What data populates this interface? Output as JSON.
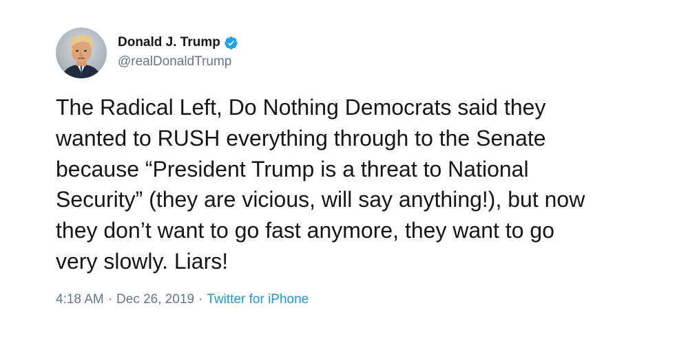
{
  "author": {
    "display_name": "Donald J. Trump",
    "handle": "@realDonaldTrump",
    "verified": true,
    "avatar_icon": "profile-photo"
  },
  "tweet": {
    "text": "The Radical Left, Do Nothing Democrats said they\nwanted to RUSH everything through to the Senate\nbecause “President Trump is a threat to National\nSecurity” (they are vicious, will say anything!), but now\nthey don’t want to go fast anymore, they want to go\nvery slowly. Liars!"
  },
  "meta": {
    "time": "4:18 AM",
    "separator": "·",
    "date": "Dec 26, 2019",
    "source": "Twitter for iPhone"
  },
  "colors": {
    "text": "#14171a",
    "secondary": "#657786",
    "link": "#1b95e0",
    "verified": "#1da1f2",
    "background": "#ffffff"
  }
}
